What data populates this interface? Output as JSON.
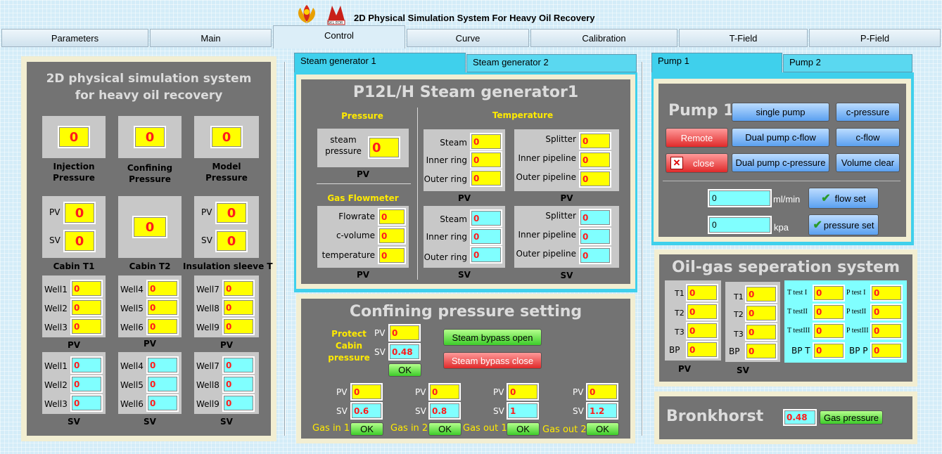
{
  "app": {
    "title": "2D Physical Simulation System For Heavy Oil Recovery",
    "logo2_text": "SKL EOR"
  },
  "tabs": [
    "Parameters",
    "Main",
    "Control",
    "Curve",
    "Calibration",
    "T-Field",
    "P-Field"
  ],
  "left": {
    "title": "2D physical simulation system for heavy oil recovery",
    "injection": {
      "value": "0",
      "label": "Injection Pressure"
    },
    "confining": {
      "value": "0",
      "label": "Confining Pressure"
    },
    "model": {
      "value": "0",
      "label": "Model Pressure"
    },
    "cabin_t1": {
      "pv": "0",
      "sv": "0",
      "label": "Cabin T1"
    },
    "cabin_t2": {
      "value": "0",
      "label": "Cabin T2"
    },
    "insulation": {
      "pv": "0",
      "sv": "0",
      "label": "Insulation sleeve T"
    },
    "pv_label": "PV",
    "sv_label": "SV",
    "wells_pv": [
      [
        "Well1",
        "0"
      ],
      [
        "Well2",
        "0"
      ],
      [
        "Well3",
        "0"
      ],
      [
        "Well4",
        "0"
      ],
      [
        "Well5",
        "0"
      ],
      [
        "Well6",
        "0"
      ],
      [
        "Well7",
        "0"
      ],
      [
        "Well8",
        "0"
      ],
      [
        "Well9",
        "0"
      ]
    ],
    "wells_sv": [
      [
        "Well1",
        "0"
      ],
      [
        "Well2",
        "0"
      ],
      [
        "Well3",
        "0"
      ],
      [
        "Well4",
        "0"
      ],
      [
        "Well5",
        "0"
      ],
      [
        "Well6",
        "0"
      ],
      [
        "Well7",
        "0"
      ],
      [
        "Well8",
        "0"
      ],
      [
        "Well9",
        "0"
      ]
    ]
  },
  "steam": {
    "tabs": [
      "Steam generator 1",
      "Steam generator 2"
    ],
    "title": "P12L/H Steam generator1",
    "pressure_hdr": "Pressure",
    "steam_pressure_label": "steam pressure",
    "steam_pressure": "0",
    "gas_hdr": "Gas Flowmeter",
    "gas": [
      [
        "Flowrate",
        "0"
      ],
      [
        "c-volume",
        "0"
      ],
      [
        "temperature",
        "0"
      ]
    ],
    "temp_hdr": "Temperature",
    "pv_a": [
      [
        "Steam",
        "0"
      ],
      [
        "Inner ring",
        "0"
      ],
      [
        "Outer ring",
        "0"
      ]
    ],
    "pv_b": [
      [
        "Splitter",
        "0"
      ],
      [
        "Inner pipeline",
        "0"
      ],
      [
        "Outer pipeline",
        "0"
      ]
    ],
    "sv_a": [
      [
        "Steam",
        "0"
      ],
      [
        "Inner ring",
        "0"
      ],
      [
        "Outer ring",
        "0"
      ]
    ],
    "sv_b": [
      [
        "Splitter",
        "0"
      ],
      [
        "Inner pipeline",
        "0"
      ],
      [
        "Outer pipeline",
        "0"
      ]
    ],
    "pv": "PV",
    "sv": "SV"
  },
  "confining": {
    "title": "Confining pressure setting",
    "protect_label": "Protect Cabin pressure",
    "protect_pv": "0",
    "protect_sv": "0.48",
    "ok": "OK",
    "bypass_open": "Steam bypass open",
    "bypass_close": "Steam bypass close",
    "pv": "PV",
    "sv": "SV",
    "gas": [
      {
        "label": "Gas in 1",
        "pv": "0",
        "sv": "0.6"
      },
      {
        "label": "Gas in 2",
        "pv": "0",
        "sv": "0.8"
      },
      {
        "label": "Gas out 1",
        "pv": "0",
        "sv": "1"
      },
      {
        "label": "Gas out 2",
        "pv": "0",
        "sv": "1.2"
      }
    ]
  },
  "pump": {
    "tabs": [
      "Pump 1",
      "Pump 2"
    ],
    "title": "Pump 1",
    "single": "single pump",
    "cpressure": "c-pressure",
    "remote": "Remote",
    "dual_cflow": "Dual pump c-flow",
    "cflow": "c-flow",
    "close": "close",
    "dual_cpressure": "Dual pump c-pressure",
    "volume_clear": "Volume clear",
    "flow_value": "0",
    "flow_unit": "ml/min",
    "flow_set": "flow set",
    "pressure_value": "0",
    "pressure_unit": "kpa",
    "pressure_set": "pressure set"
  },
  "oilgas": {
    "title": "Oil-gas seperation system",
    "pv_rows": [
      [
        "T1",
        "0"
      ],
      [
        "T2",
        "0"
      ],
      [
        "T3",
        "0"
      ],
      [
        "BP",
        "0"
      ]
    ],
    "sv_rows": [
      [
        "T1",
        "0"
      ],
      [
        "T2",
        "0"
      ],
      [
        "T3",
        "0"
      ],
      [
        "BP",
        "0"
      ]
    ],
    "tests": [
      [
        "T test I",
        "0",
        "P test I",
        "0"
      ],
      [
        "T testII",
        "0",
        "P testII",
        "0"
      ],
      [
        "T testIII",
        "0",
        "P testIII",
        "0"
      ],
      [
        "BP T",
        "0",
        "BP P",
        "0"
      ]
    ],
    "pv": "PV",
    "sv": "SV"
  },
  "bronkhorst": {
    "title": "Bronkhorst",
    "value": "0.48",
    "button": "Gas pressure"
  }
}
